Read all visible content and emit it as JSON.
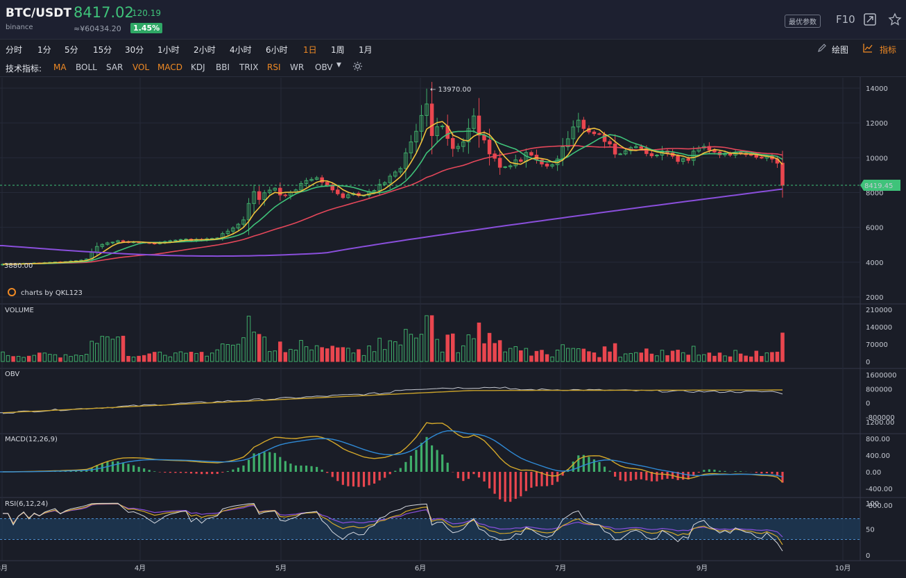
{
  "header": {
    "pair": "BTC/USDT",
    "exchange": "binance",
    "price": "8417.02",
    "change": "120.19",
    "cny_price": "≈¥60434.20",
    "change_pct": "1.45%",
    "params_button": "最优参数",
    "f10_label": "F10"
  },
  "toolbar": {
    "intervals": [
      "分时",
      "1分",
      "5分",
      "15分",
      "30分",
      "1小时",
      "2小时",
      "4小时",
      "6小时",
      "1日",
      "1周",
      "1月"
    ],
    "active_interval": "1日",
    "draw_label": "绘图",
    "indicator_label": "指标"
  },
  "indicators": {
    "label": "技术指标:",
    "items": [
      "MA",
      "BOLL",
      "SAR",
      "VOL",
      "MACD",
      "KDJ",
      "BBI",
      "TRIX",
      "RSI",
      "WR",
      "OBV"
    ],
    "active": [
      "MA",
      "VOL",
      "MACD",
      "RSI"
    ]
  },
  "colors": {
    "up": "#3fae6a",
    "down": "#e9464f",
    "ma5": "#f2c33d",
    "ma10": "#3fc37a",
    "ma30": "#e5475a",
    "ma200": "#8a4fdc",
    "accent": "#f08a24"
  },
  "chart_data": [
    {
      "type": "candlestick",
      "title": "BTC/USDT 1日",
      "x_ticks": [
        "3月",
        "4月",
        "5月",
        "6月",
        "7月",
        "8月",
        "9月",
        "10月"
      ],
      "y_ticks": [
        14000,
        12000,
        10000,
        8000,
        6000,
        4000,
        2000
      ],
      "ylim": [
        2000,
        14000
      ],
      "last_price_label": "8419.45",
      "high_label": "← 13970.00",
      "low_label": "3880.00",
      "watermark": "charts by QKL123",
      "close_series": [
        3880,
        3905,
        3890,
        3910,
        3930,
        3920,
        3950,
        3945,
        3970,
        3990,
        4010,
        4000,
        4030,
        4060,
        4080,
        4110,
        4180,
        4560,
        4900,
        5020,
        5110,
        5150,
        5230,
        5180,
        5130,
        5160,
        5140,
        5120,
        5090,
        5060,
        5110,
        5180,
        5230,
        5260,
        5300,
        5320,
        5250,
        5310,
        5270,
        5340,
        5360,
        5390,
        5640,
        5780,
        5960,
        6180,
        6430,
        7370,
        8050,
        7600,
        7990,
        8140,
        8250,
        7860,
        7820,
        8020,
        8150,
        8520,
        8690,
        8760,
        8850,
        8590,
        8440,
        8150,
        7930,
        7710,
        7870,
        7950,
        7830,
        7840,
        8050,
        8120,
        8470,
        8570,
        8940,
        9180,
        9380,
        10280,
        10910,
        11520,
        12430,
        13090,
        11270,
        11780,
        11820,
        11110,
        10530,
        10650,
        10910,
        11680,
        12400,
        11300,
        11020,
        10220,
        9970,
        9450,
        9480,
        9540,
        9880,
        9790,
        10300,
        10150,
        9880,
        9640,
        9520,
        9600,
        9930,
        10630,
        11090,
        11770,
        12160,
        11680,
        11480,
        11380,
        11340,
        10930,
        10790,
        10210,
        10220,
        10400,
        10580,
        10640,
        10530,
        10240,
        10110,
        10150,
        10390,
        10270,
        10090,
        9790,
        9940,
        9850,
        10380,
        10560,
        10650,
        10440,
        10330,
        10170,
        10250,
        10150,
        10320,
        10250,
        10180,
        10160,
        10030,
        9980,
        10080,
        9930,
        9690,
        8417
      ],
      "ma200_start": 4950,
      "ma200_end": 8200
    },
    {
      "type": "bar",
      "title": "VOLUME",
      "y_ticks": [
        210000,
        140000,
        70000,
        0
      ],
      "ylim": [
        0,
        210000
      ],
      "max_value": 185000
    },
    {
      "type": "line",
      "title": "OBV",
      "y_ticks": [
        1600000,
        800000,
        0,
        -800000
      ],
      "ylim": [
        -1200000,
        1600000
      ]
    },
    {
      "type": "line",
      "title": "MACD(12,26,9)",
      "y_ticks": [
        1200,
        800,
        400,
        0,
        -400,
        -800
      ],
      "y_tick_labels": [
        "1200.00",
        "800.00",
        "400.00",
        "0.00",
        "-400.00",
        "-800.00"
      ],
      "ylim": [
        -900,
        1300
      ]
    },
    {
      "type": "line",
      "title": "RSI(6,12,24)",
      "y_ticks": [
        100,
        50,
        0
      ],
      "ylim": [
        0,
        100
      ],
      "bands": [
        30,
        70
      ]
    }
  ]
}
